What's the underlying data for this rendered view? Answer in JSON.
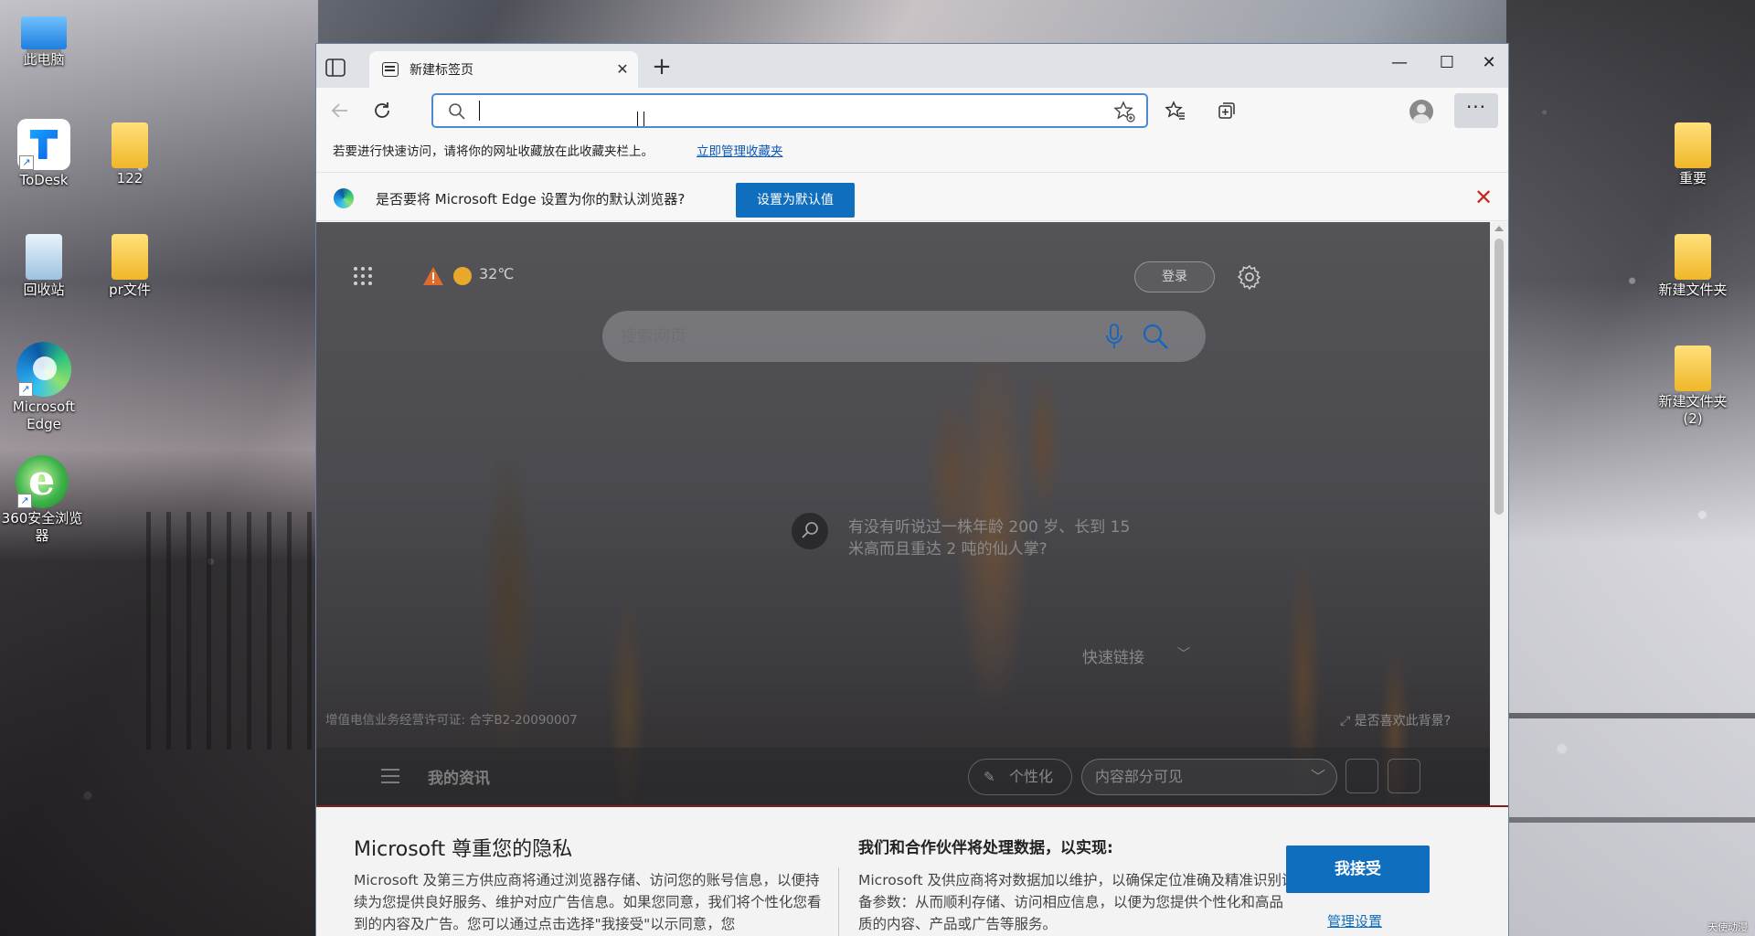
{
  "desktop": {
    "icons_left": [
      {
        "label": "此电脑",
        "icon": "computer-icon"
      },
      {
        "label": "ToDesk",
        "icon": "todesk-icon"
      },
      {
        "label": "122",
        "icon": "folder-icon"
      },
      {
        "label": "回收站",
        "icon": "recycle-bin-icon"
      },
      {
        "label": "pr文件",
        "icon": "folder-icon"
      },
      {
        "label": "Microsoft Edge",
        "icon": "edge-icon"
      },
      {
        "label": "360安全浏览器",
        "icon": "360-browser-icon"
      }
    ],
    "icons_right": [
      {
        "label": "重要",
        "icon": "folder-icon"
      },
      {
        "label": "新建文件夹",
        "icon": "folder-icon"
      },
      {
        "label": "新建文件夹 (2)",
        "icon": "folder-icon"
      }
    ],
    "watermark": "天使动漫"
  },
  "browser": {
    "tab": {
      "title": "新建标签页",
      "close": "✕"
    },
    "new_tab": "+",
    "window_controls": {
      "minimize": "—",
      "maximize": "☐",
      "close": "✕"
    },
    "address": {
      "value": "",
      "placeholder": ""
    },
    "more": "···",
    "favorites_bar": {
      "hint": "若要进行快速访问，请将你的网址收藏放在此收藏夹栏上。",
      "link": "立即管理收藏夹"
    },
    "infobar": {
      "message": "是否要将 Microsoft Edge 设置为你的默认浏览器?",
      "button": "设置为默认值",
      "close": "✕"
    },
    "new_tab_page": {
      "temperature": "32℃",
      "login": "登录",
      "search_placeholder": "搜索网页",
      "trivia": "有没有听说过一株年龄 200 岁、长到 15 米高而且重达 2 吨的仙人掌?",
      "quick_links": "快速链接",
      "license": "增值电信业务经营许可证: 合字B2-20090007",
      "like_background": "是否喜欢此背景?",
      "feed": {
        "my_feed": "我的资讯",
        "personalize": "个性化",
        "visibility": "内容部分可见"
      }
    },
    "privacy": {
      "title": "Microsoft 尊重您的隐私",
      "body": "Microsoft 及第三方供应商将通过浏览器存储、访问您的账号信息，以便持续为您提供良好服务、维护对应广告信息。如果您同意，我们将个性化您看到的内容及广告。您可以通过点击选择\"我接受\"以示同意，您",
      "right_title": "我们和合作伙伴将处理数据，以实现:",
      "right_body": "Microsoft 及供应商将对数据加以维护，以确保定位准确及精准识别设备参数：从而顺利存储、访问相应信息，以便为您提供个性化和高品质的内容、产品或广告等服务。",
      "accept": "我接受",
      "manage": "管理设置"
    }
  }
}
